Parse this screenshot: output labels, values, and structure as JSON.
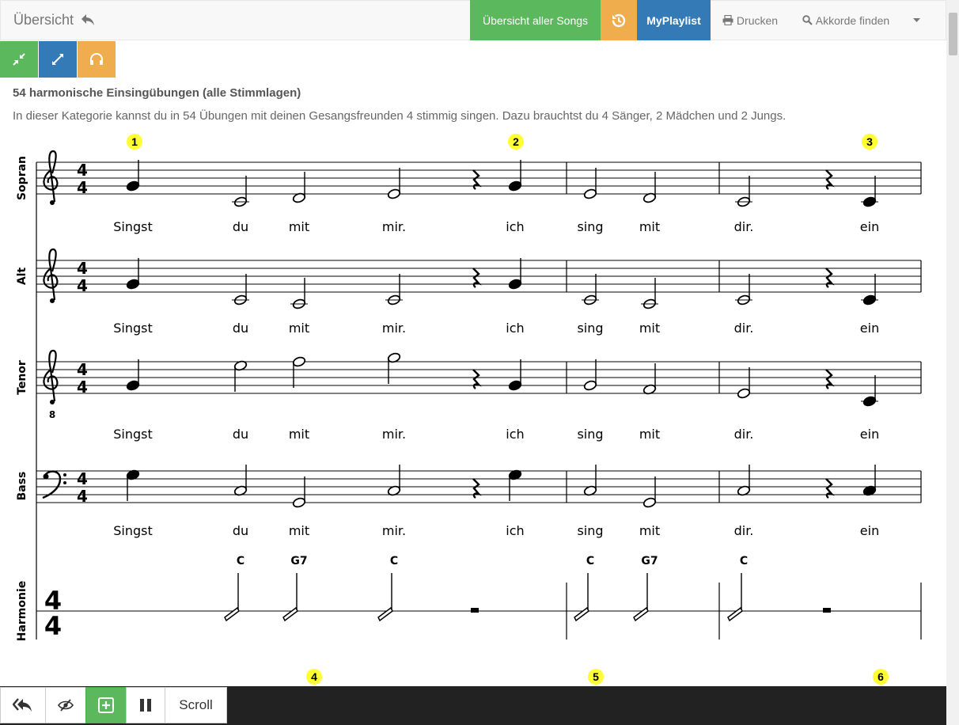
{
  "header": {
    "brand": "Übersicht",
    "buttons": {
      "all_songs": "Übersicht aller Songs",
      "myplaylist": "MyPlaylist",
      "print": "Drucken",
      "find_chords": "Akkorde finden"
    }
  },
  "toolbar": {
    "icons": [
      "compress-icon",
      "expand-icon",
      "headphones-icon"
    ],
    "colors": [
      "#5cb85c",
      "#337ab7",
      "#f0ad4e"
    ]
  },
  "content": {
    "title": "54 harmonische Einsingübungen (alle Stimmlagen)",
    "description": "In dieser Kategorie kannst du in 54 Übungen mit deinen Gesangsfreunden 4 stimmig singen. Dazu brauchtst du 4 Sänger, 2 Mädchen und 2 Jungs."
  },
  "score": {
    "exercise_markers_top": [
      "1",
      "2",
      "3"
    ],
    "exercise_markers_bottom": [
      "4",
      "5",
      "6"
    ],
    "time_signature_top": "4",
    "time_signature_bottom": "4",
    "tenor_clef_octave": "8",
    "staves": [
      {
        "name": "Sopran",
        "lyrics": [
          "Singst",
          "du",
          "mit",
          "mir.",
          "ich",
          "sing",
          "mit",
          "dir.",
          "ein"
        ]
      },
      {
        "name": "Alt",
        "lyrics": [
          "Singst",
          "du",
          "mit",
          "mir.",
          "ich",
          "sing",
          "mit",
          "dir.",
          "ein"
        ]
      },
      {
        "name": "Tenor",
        "lyrics": [
          "Singst",
          "du",
          "mit",
          "mir.",
          "ich",
          "sing",
          "mit",
          "dir.",
          "ein"
        ]
      },
      {
        "name": "Bass",
        "lyrics": [
          "Singst",
          "du",
          "mit",
          "mir.",
          "ich",
          "sing",
          "mit",
          "dir.",
          "ein"
        ]
      }
    ],
    "harmony": {
      "name": "Harmonie",
      "chords": [
        "C",
        "G7",
        "C",
        "C",
        "G7",
        "C"
      ]
    }
  },
  "bottombar": {
    "scroll_label": "Scroll"
  },
  "colors": {
    "green": "#5cb85c",
    "orange": "#f0ad4e",
    "blue": "#337ab7",
    "marker": "#ffff33",
    "bottom_bar": "#222222"
  }
}
